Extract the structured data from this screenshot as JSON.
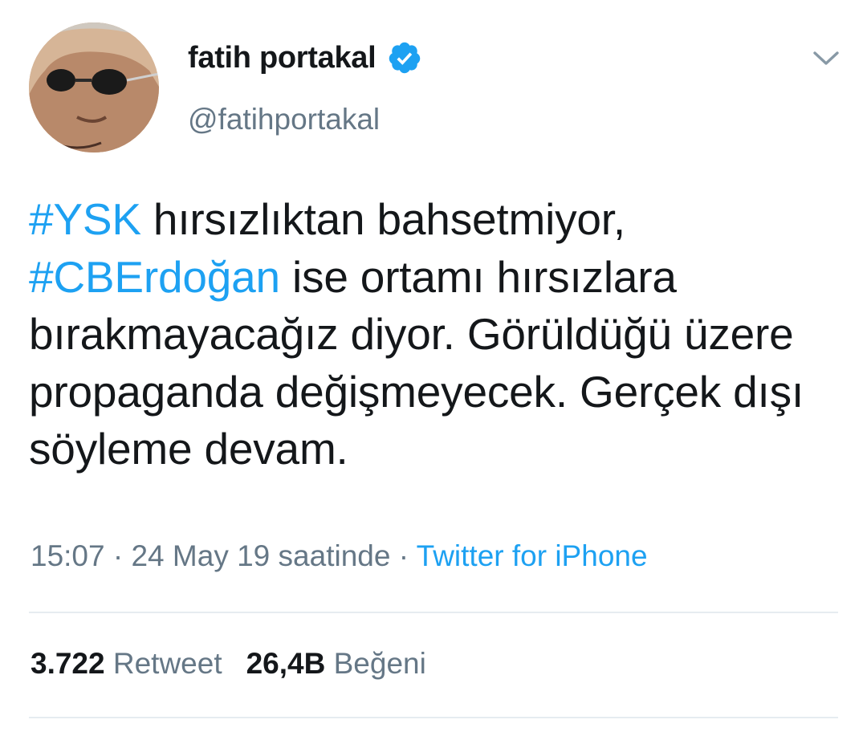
{
  "author": {
    "display_name": "fatih portakal",
    "handle": "@fatihportakal",
    "verified_icon": "verified-badge-icon",
    "colors": {
      "verified": "#1da1f2"
    }
  },
  "tweet": {
    "segments": [
      {
        "text": "#YSK",
        "type": "hashtag"
      },
      {
        "text": " hırsızlıktan bahsetmiyor, ",
        "type": "text"
      },
      {
        "text": "#CBErdoğan",
        "type": "hashtag"
      },
      {
        "text": " ise ortamı hırsızlara bırakmayacağız diyor. Görüldüğü üzere propaganda değişmeyecek. Gerçek dışı söyleme devam.",
        "type": "text"
      }
    ],
    "hashtag_color": "#1da1f2"
  },
  "meta": {
    "time": "15:07",
    "sep1": " · ",
    "date": "24 May 19 saatinde",
    "sep2": " · ",
    "source": "Twitter for iPhone"
  },
  "stats": {
    "retweets_count": "3.722",
    "retweets_label": "Retweet",
    "likes_count": "26,4B",
    "likes_label": "Beğeni"
  },
  "menu": {
    "icon": "chevron-down-icon"
  }
}
